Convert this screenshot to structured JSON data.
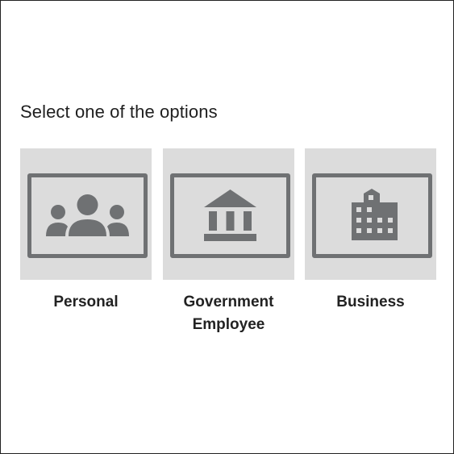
{
  "prompt": "Select one of the options",
  "colors": {
    "tile_bg": "#dcdcdc",
    "icon": "#6f7173",
    "text": "#222222"
  },
  "options": [
    {
      "label_lines": [
        "Personal"
      ],
      "icon": "people-group-icon"
    },
    {
      "label_lines": [
        "Government",
        "Employee"
      ],
      "icon": "bank-building-icon"
    },
    {
      "label_lines": [
        "Business"
      ],
      "icon": "office-building-icon"
    }
  ]
}
